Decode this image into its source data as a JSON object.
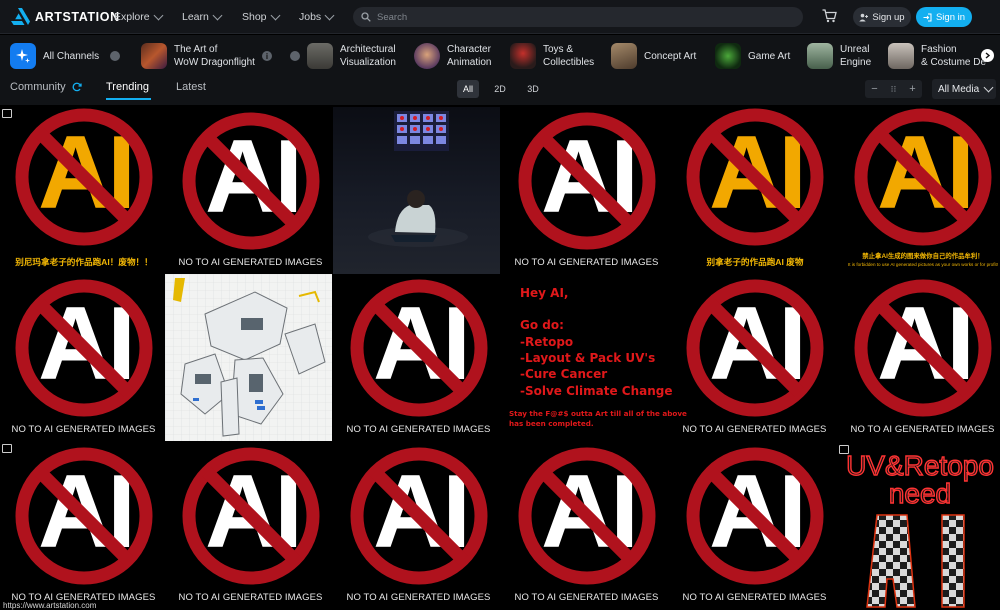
{
  "brand": {
    "logo_text": "ARTSTATION"
  },
  "nav": {
    "links": [
      {
        "label": "Explore"
      },
      {
        "label": "Learn"
      },
      {
        "label": "Shop"
      },
      {
        "label": "Jobs"
      }
    ],
    "search_placeholder": "Search",
    "signup_label": "Sign up",
    "signin_label": "Sign in"
  },
  "channels": [
    {
      "label_1": "All Channels",
      "label_2": ""
    },
    {
      "label_1": "The Art of",
      "label_2": "WoW Dragonflight"
    },
    {
      "label_1": "Architectural",
      "label_2": "Visualization"
    },
    {
      "label_1": "Character",
      "label_2": "Animation"
    },
    {
      "label_1": "Toys &",
      "label_2": "Collectibles"
    },
    {
      "label_1": "Concept Art",
      "label_2": ""
    },
    {
      "label_1": "Game Art",
      "label_2": ""
    },
    {
      "label_1": "Unreal",
      "label_2": "Engine"
    },
    {
      "label_1": "Fashion",
      "label_2": "& Costume De"
    }
  ],
  "filters": {
    "tabs": [
      {
        "label": "Community"
      },
      {
        "label": "Trending"
      },
      {
        "label": "Latest"
      }
    ],
    "active_tab": "Trending",
    "dimensions": [
      {
        "label": "All"
      },
      {
        "label": "2D"
      },
      {
        "label": "3D"
      }
    ],
    "active_dimension": "All",
    "size_controls": [
      "−",
      "⁝⁝",
      "+"
    ],
    "media_select": "All Media"
  },
  "artworks": {
    "no_ai_caption": "NO TO AI GENERATED IMAGES",
    "cn_caption_1": "别尼玛拿老子的作品跑AI！废物！！",
    "cn_caption_2": "别拿老子的作品跑AI  废物",
    "cn_caption_3": "禁止拿AI生成的图来做你自己的作品牟利！",
    "en_small_caption_3": "It is forbidden to use AI generated pictures as your own works or for profit!",
    "hey_ai": {
      "lines": [
        "Hey AI,",
        "Go do:",
        "-Retopo",
        "-Layout & Pack UV's",
        "-Cure Cancer",
        "-Solve Climate Change"
      ],
      "footer_1": "Stay the F@#$ outta Art till all of the above",
      "footer_2": "has been completed."
    },
    "uv_retopo": {
      "line_1": "UV&Retopo",
      "line_2": "need",
      "line_3": "AI"
    }
  },
  "status_url": "https://www.artstation.com",
  "colors": {
    "accent": "#13aff0",
    "no_sign_red": "#b0121d",
    "ai_letters_white": "#ffffff",
    "ai_letters_gold": "#f2a800"
  }
}
